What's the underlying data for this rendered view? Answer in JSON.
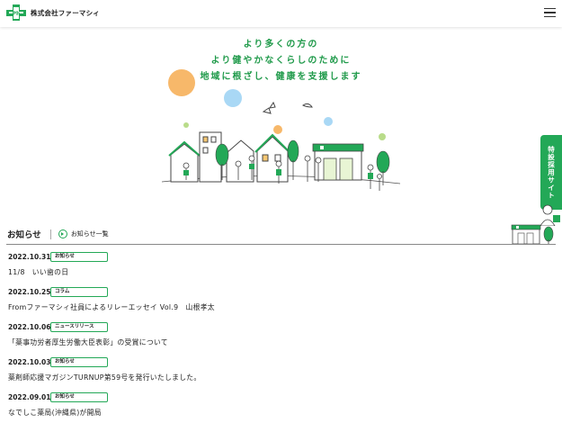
{
  "header": {
    "company_name": "株式会社ファーマシィ",
    "menu_icon": "hamburger-menu-icon"
  },
  "hero": {
    "lines": [
      "より多くの方の",
      "より健やかなくらしのために",
      "地域に根ざし、健康を支援します"
    ]
  },
  "side_tab": {
    "label": "特設採用サイト"
  },
  "news": {
    "title": "お知らせ",
    "all_link": "お知らせ一覧",
    "items": [
      {
        "date": "2022.10.31",
        "tag": "お知らせ",
        "text": "11/8　いい歯の日"
      },
      {
        "date": "2022.10.25",
        "tag": "コラム",
        "text": "Fromファーマシィ社員によるリレーエッセイ Vol.9　山根孝太"
      },
      {
        "date": "2022.10.06",
        "tag": "ニュースリリース",
        "text": "「薬事功労者厚生労働大臣表彰」の受賞について"
      },
      {
        "date": "2022.10.03",
        "tag": "お知らせ",
        "text": "薬剤師応援マガジンTURNUP第59号を発行いたしました。"
      },
      {
        "date": "2022.09.01",
        "tag": "お知らせ",
        "text": "なでしこ薬局(沖縄県)が開局"
      }
    ]
  },
  "colors": {
    "brand_green": "#23a857",
    "hero_text": "#1f9a4a"
  }
}
